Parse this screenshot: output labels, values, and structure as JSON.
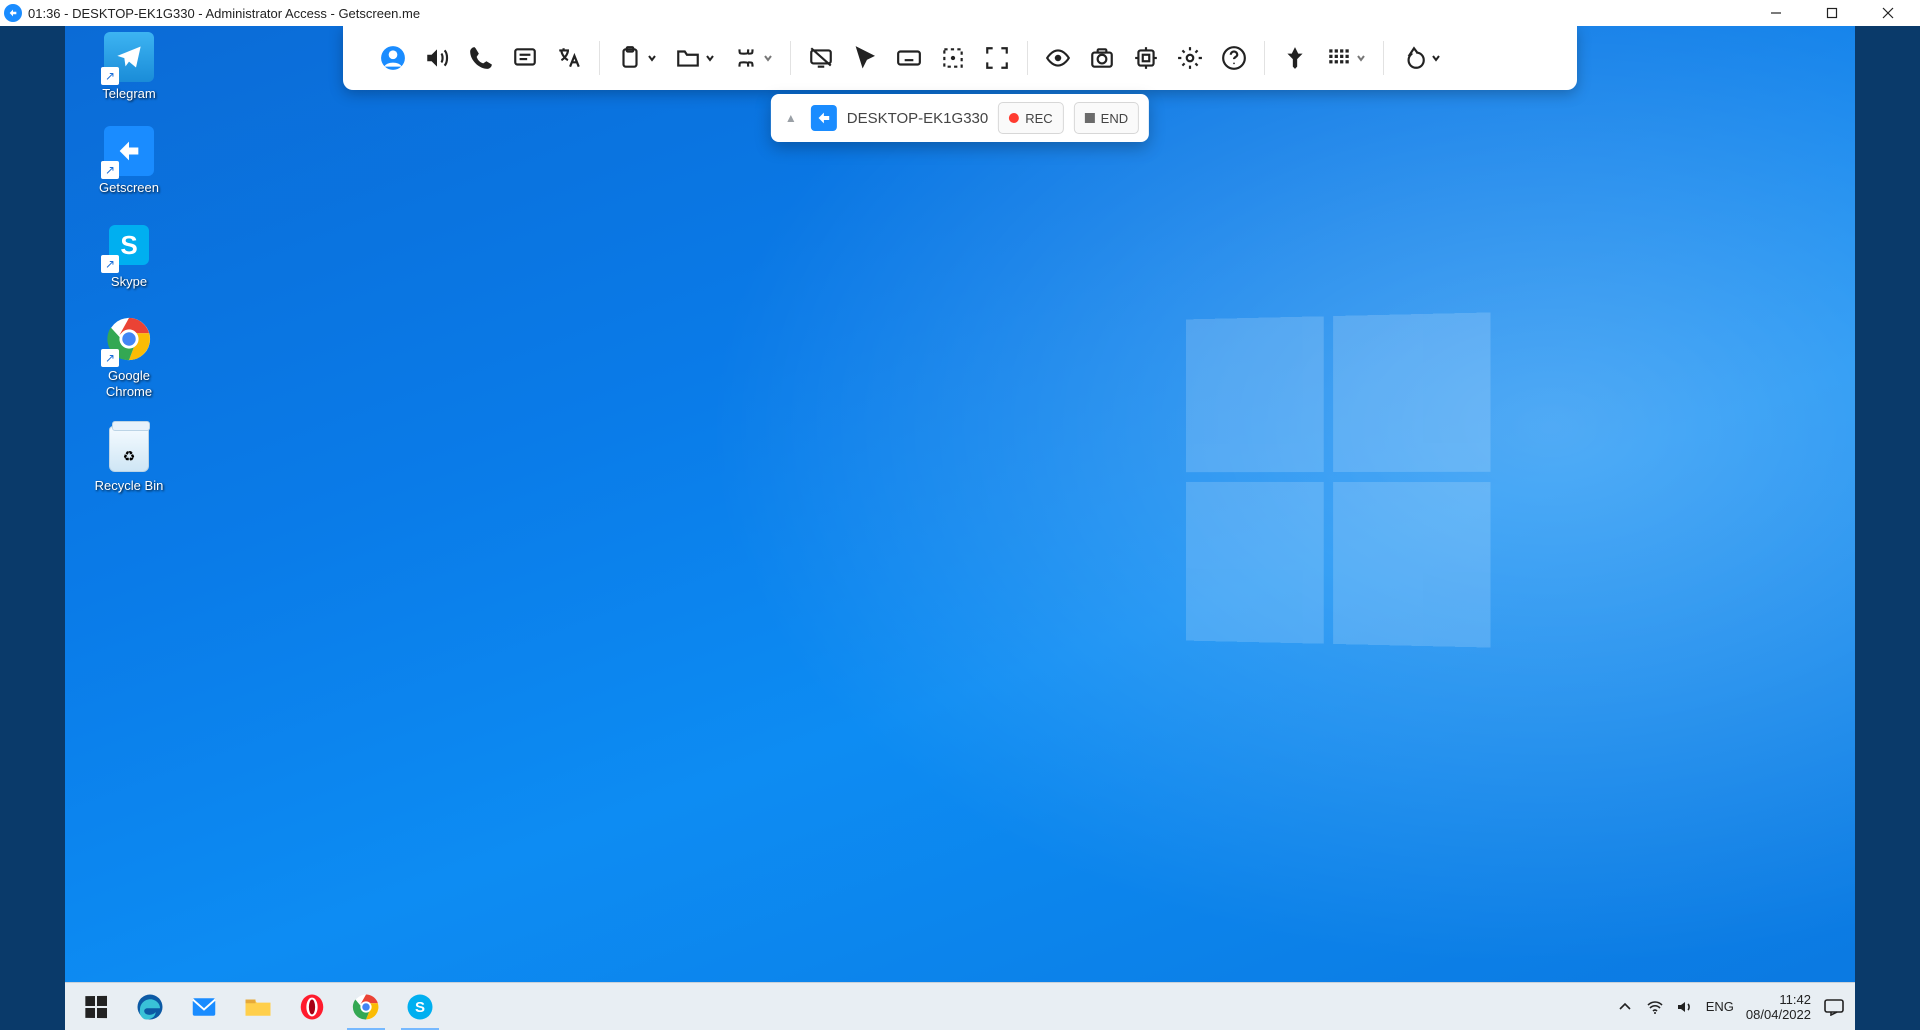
{
  "app_title": {
    "timer": "01:36",
    "host": "DESKTOP-EK1G330",
    "access": "Administrator Access",
    "brand": "Getscreen.me",
    "full": "01:36 - DESKTOP-EK1G330 - Administrator Access - Getscreen.me"
  },
  "toolbar_icons": [
    "account",
    "sound",
    "call",
    "chat",
    "translate",
    "clipboard",
    "files",
    "shortcuts",
    "blank-screen",
    "cursor",
    "keyboard",
    "screenshot-area",
    "fullscreen",
    "view",
    "camera",
    "system",
    "settings",
    "help",
    "pin",
    "quality",
    "shape"
  ],
  "session": {
    "name": "DESKTOP-EK1G330",
    "rec_label": "REC",
    "end_label": "END"
  },
  "desktop_icons": [
    {
      "id": "telegram",
      "label": "Telegram"
    },
    {
      "id": "getscreen",
      "label": "Getscreen"
    },
    {
      "id": "skype",
      "label": "Skype"
    },
    {
      "id": "chrome",
      "label": "Google\nChrome"
    },
    {
      "id": "recycle",
      "label": "Recycle Bin"
    }
  ],
  "taskbar_apps": [
    {
      "id": "edge",
      "active": false
    },
    {
      "id": "mail",
      "active": false
    },
    {
      "id": "explorer",
      "active": false
    },
    {
      "id": "opera",
      "active": false
    },
    {
      "id": "chrome",
      "active": true
    },
    {
      "id": "skype",
      "active": true
    }
  ],
  "tray": {
    "lang": "ENG",
    "time": "11:42",
    "date": "08/04/2022"
  },
  "colors": {
    "accent": "#1a8cff",
    "rec": "#ff3b30"
  }
}
